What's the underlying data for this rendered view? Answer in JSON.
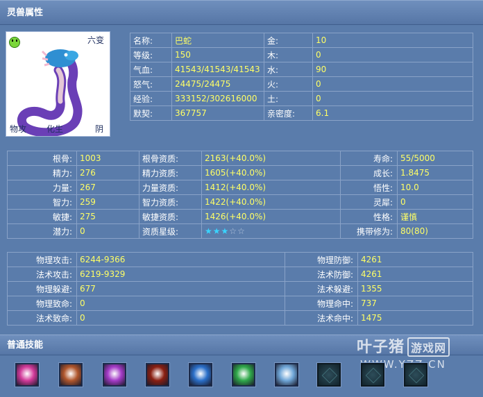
{
  "header": {
    "title": "灵兽属性"
  },
  "portrait": {
    "transform": "六变",
    "attack_type": "物攻",
    "element": "化生",
    "polarity": "阴"
  },
  "basic": [
    {
      "k1": "名称:",
      "v1": "巴蛇",
      "k2": "金:",
      "v2": "10"
    },
    {
      "k1": "等级:",
      "v1": "150",
      "k2": "木:",
      "v2": "0"
    },
    {
      "k1": "气血:",
      "v1": "41543/41543/41543",
      "k2": "水:",
      "v2": "90"
    },
    {
      "k1": "怒气:",
      "v1": "24475/24475",
      "k2": "火:",
      "v2": "0"
    },
    {
      "k1": "经验:",
      "v1": "333152/302616000",
      "k2": "土:",
      "v2": "0"
    },
    {
      "k1": "默契:",
      "v1": "367757",
      "k2": "亲密度:",
      "v2": "6.1"
    }
  ],
  "attributes": [
    {
      "k1": "根骨:",
      "v1": "1003",
      "k2": "根骨资质:",
      "v2": "2163(+40.0%)",
      "k3": "寿命:",
      "v3": "55/5000"
    },
    {
      "k1": "精力:",
      "v1": "276",
      "k2": "精力资质:",
      "v2": "1605(+40.0%)",
      "k3": "成长:",
      "v3": "1.8475"
    },
    {
      "k1": "力量:",
      "v1": "267",
      "k2": "力量资质:",
      "v2": "1412(+40.0%)",
      "k3": "悟性:",
      "v3": "10.0"
    },
    {
      "k1": "智力:",
      "v1": "259",
      "k2": "智力资质:",
      "v2": "1422(+40.0%)",
      "k3": "灵犀:",
      "v3": "0"
    },
    {
      "k1": "敏捷:",
      "v1": "275",
      "k2": "敏捷资质:",
      "v2": "1426(+40.0%)",
      "k3": "性格:",
      "v3": "谨慎"
    },
    {
      "k1": "潜力:",
      "v1": "0",
      "k2": "资质星级:",
      "v2": "",
      "k3": "携带修为:",
      "v3": "80(80)"
    }
  ],
  "star_rating": {
    "filled": 3,
    "total": 5
  },
  "combat": [
    {
      "k1": "物理攻击:",
      "v1": "6244-9366",
      "k2": "物理防御:",
      "v2": "4261"
    },
    {
      "k1": "法术攻击:",
      "v1": "6219-9329",
      "k2": "法术防御:",
      "v2": "4261"
    },
    {
      "k1": "物理躲避:",
      "v1": "677",
      "k2": "法术躲避:",
      "v2": "1355"
    },
    {
      "k1": "物理致命:",
      "v1": "0",
      "k2": "物理命中:",
      "v2": "737"
    },
    {
      "k1": "法术致命:",
      "v1": "0",
      "k2": "法术命中:",
      "v2": "1475"
    }
  ],
  "skills": {
    "title": "普通技能",
    "items": [
      {
        "icon": "pink-orb-skill-icon",
        "color": "#d23a9a"
      },
      {
        "icon": "beast-claw-skill-icon",
        "color": "#b0562c"
      },
      {
        "icon": "purple-burst-skill-icon",
        "color": "#a43bc7"
      },
      {
        "icon": "red-eye-skill-icon",
        "color": "#8a1f12"
      },
      {
        "icon": "blue-rune-skill-icon",
        "color": "#2a6fc9"
      },
      {
        "icon": "green-vortex-skill-icon",
        "color": "#2fa84a"
      },
      {
        "icon": "light-slash-skill-icon",
        "color": "#6fa6d8"
      },
      {
        "icon": "empty-slot-icon",
        "color": "#1e3a44"
      },
      {
        "icon": "empty-slot-icon",
        "color": "#1e3a44"
      },
      {
        "icon": "empty-slot-icon",
        "color": "#1e3a44"
      }
    ]
  },
  "watermark": {
    "name": "叶子猪",
    "tag": "游戏网",
    "url": "WWW.YZZ.CN"
  }
}
